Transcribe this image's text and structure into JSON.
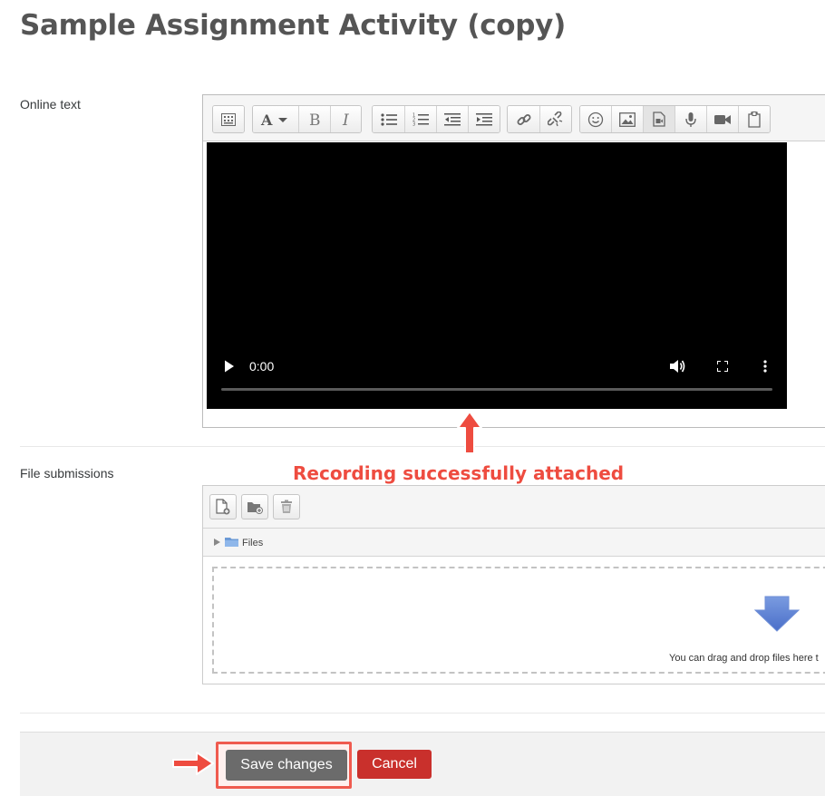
{
  "page": {
    "title": "Sample Assignment Activity (copy)"
  },
  "online_text": {
    "label": "Online text",
    "toolbar_icons": [
      "show-more-icon",
      "font-color-icon",
      "bold-icon",
      "italic-icon",
      "unordered-list-icon",
      "ordered-list-icon",
      "outdent-icon",
      "indent-icon",
      "link-icon",
      "unlink-icon",
      "emoji-icon",
      "image-icon",
      "media-icon",
      "record-audio-icon",
      "record-video-icon",
      "manage-files-icon"
    ],
    "video": {
      "time": "0:00"
    }
  },
  "annotations": {
    "recording": "Recording successfully attached",
    "color": "#ee4c40"
  },
  "file_submissions": {
    "label": "File submissions",
    "path": "Files",
    "drop_hint": "You can drag and drop files here t"
  },
  "footer": {
    "save_label": "Save changes",
    "cancel_label": "Cancel"
  },
  "colors": {
    "save": "#6b6b6b",
    "cancel": "#c9302c",
    "annotation": "#ee4c40"
  }
}
